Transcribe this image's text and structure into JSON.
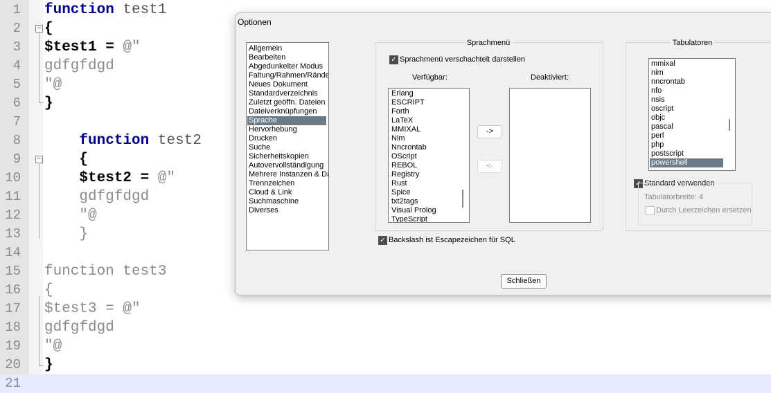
{
  "editor": {
    "lines": [
      {
        "num": "1",
        "segments": [
          {
            "t": "function",
            "c": "kw"
          },
          {
            "t": " test1",
            "c": "fn"
          }
        ]
      },
      {
        "num": "2",
        "segments": [
          {
            "t": "{",
            "c": "brace"
          }
        ]
      },
      {
        "num": "3",
        "segments": [
          {
            "t": "$test1",
            "c": "var"
          },
          {
            "t": " = ",
            "c": "op"
          },
          {
            "t": "@\"",
            "c": "str"
          }
        ]
      },
      {
        "num": "4",
        "segments": [
          {
            "t": "gdfgfdgd",
            "c": "str"
          }
        ]
      },
      {
        "num": "5",
        "segments": [
          {
            "t": "\"@",
            "c": "str"
          }
        ]
      },
      {
        "num": "6",
        "segments": [
          {
            "t": "}",
            "c": "brace"
          }
        ]
      },
      {
        "num": "7",
        "segments": []
      },
      {
        "num": "8",
        "segments": [
          {
            "t": "    function",
            "c": "kw"
          },
          {
            "t": " test2",
            "c": "fn"
          }
        ]
      },
      {
        "num": "9",
        "segments": [
          {
            "t": "    {",
            "c": "brace"
          }
        ]
      },
      {
        "num": "10",
        "segments": [
          {
            "t": "    $test2",
            "c": "var"
          },
          {
            "t": " = ",
            "c": "op"
          },
          {
            "t": "@\"",
            "c": "str"
          }
        ]
      },
      {
        "num": "11",
        "segments": [
          {
            "t": "    gdfgfdgd",
            "c": "str"
          }
        ]
      },
      {
        "num": "12",
        "segments": [
          {
            "t": "    \"@",
            "c": "str"
          }
        ]
      },
      {
        "num": "13",
        "segments": [
          {
            "t": "    }",
            "c": "dim"
          }
        ]
      },
      {
        "num": "14",
        "segments": []
      },
      {
        "num": "15",
        "segments": [
          {
            "t": "function test3",
            "c": "dim"
          }
        ]
      },
      {
        "num": "16",
        "segments": [
          {
            "t": "{",
            "c": "dim"
          }
        ]
      },
      {
        "num": "17",
        "segments": [
          {
            "t": "$test3 = @\"",
            "c": "dim"
          }
        ]
      },
      {
        "num": "18",
        "segments": [
          {
            "t": "gdfgfdgd",
            "c": "dim"
          }
        ]
      },
      {
        "num": "19",
        "segments": [
          {
            "t": "\"@",
            "c": "dim"
          }
        ]
      },
      {
        "num": "20",
        "segments": [
          {
            "t": "}",
            "c": "brace"
          }
        ]
      },
      {
        "num": "21",
        "segments": []
      }
    ],
    "fold_markers": {
      "open": "−",
      "close": ""
    }
  },
  "dialog": {
    "title": "Optionen",
    "categories": [
      "Allgemein",
      "Bearbeiten",
      "Abgedunkelter Modus",
      "Faltung/Rahmen/Ränder",
      "Neues Dokument",
      "Standardverzeichnis",
      "Zuletzt geöffn. Dateien",
      "Dateiverknüpfungen",
      "Sprache",
      "Hervorhebung",
      "Drucken",
      "Suche",
      "Sicherheitskopien",
      "Autovervollständigung",
      "Mehrere Instanzen & Datum",
      "Trennzeichen",
      "Cloud & Link",
      "Suchmaschine",
      "Diverses"
    ],
    "selected_category": "Sprache",
    "sprachmenu": {
      "group_title": "Sprachmenü",
      "nested_label": "Sprachmenü verschachtelt darstellen",
      "nested_checked": true,
      "available_label": "Verfügbar:",
      "disabled_label": "Deaktiviert:",
      "available": [
        "Erlang",
        "ESCRIPT",
        "Forth",
        "LaTeX",
        "MMIXAL",
        "Nim",
        "Nncrontab",
        "OScript",
        "REBOL",
        "Registry",
        "Rust",
        "Spice",
        "txt2tags",
        "Visual Prolog",
        "TypeScript"
      ],
      "deactivated": [],
      "move_right": "->",
      "move_left": "<-"
    },
    "backslash_label": "Backslash ist Escapezeichen für SQL",
    "backslash_checked": true,
    "tabs": {
      "group_title": "Tabulatoren",
      "languages": [
        "mmixal",
        "nim",
        "nncrontab",
        "nfo",
        "nsis",
        "oscript",
        "objc",
        "pascal",
        "perl",
        "php",
        "postscript",
        "powershell"
      ],
      "selected_language": "powershell",
      "use_default_label": "Standard verwenden",
      "use_default_checked": true,
      "tab_width_label": "Tabulatorbreite: 4",
      "replace_spaces_label": "Durch Leerzeichen ersetzen",
      "replace_spaces_checked": false
    },
    "close_button": "Schließen"
  }
}
